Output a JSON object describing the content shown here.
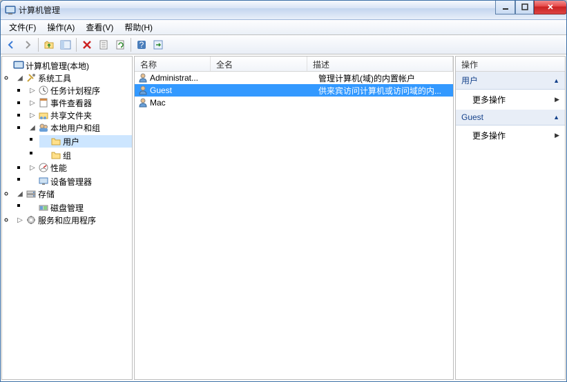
{
  "title": "计算机管理",
  "menus": [
    "文件(F)",
    "操作(A)",
    "查看(V)",
    "帮助(H)"
  ],
  "tree": {
    "root": "计算机管理(本地)",
    "system_tools": "系统工具",
    "task_scheduler": "任务计划程序",
    "event_viewer": "事件查看器",
    "shared_folders": "共享文件夹",
    "local_users": "本地用户和组",
    "users": "用户",
    "groups": "组",
    "performance": "性能",
    "device_manager": "设备管理器",
    "storage": "存储",
    "disk_mgmt": "磁盘管理",
    "services_apps": "服务和应用程序"
  },
  "list": {
    "headers": {
      "name": "名称",
      "fullname": "全名",
      "desc": "描述"
    },
    "rows": [
      {
        "name": "Administrat...",
        "fullname": "",
        "desc": "管理计算机(域)的内置帐户"
      },
      {
        "name": "Guest",
        "fullname": "",
        "desc": "供来宾访问计算机或访问域的内..."
      },
      {
        "name": "Mac",
        "fullname": "",
        "desc": ""
      }
    ]
  },
  "actions": {
    "header": "操作",
    "section1": "用户",
    "item1": "更多操作",
    "section2": "Guest",
    "item2": "更多操作"
  }
}
